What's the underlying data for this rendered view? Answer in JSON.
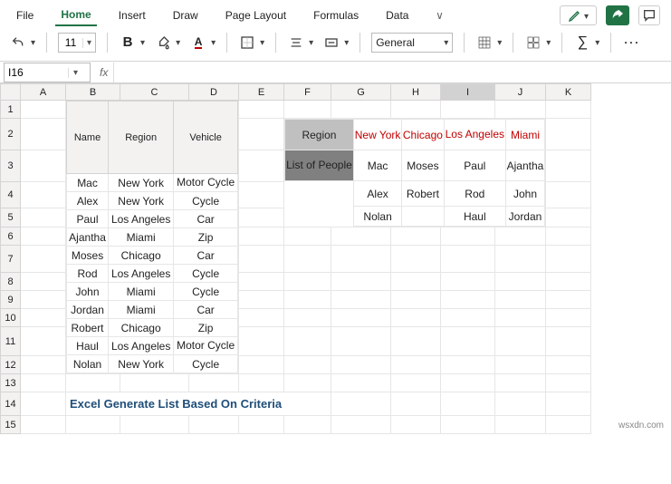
{
  "menu": {
    "file": "File",
    "home": "Home",
    "insert": "Insert",
    "draw": "Draw",
    "pageLayout": "Page Layout",
    "formulas": "Formulas",
    "data": "Data"
  },
  "toolbar": {
    "fontSize": "11",
    "bold": "B",
    "numberFormat": "General",
    "dots": "···"
  },
  "fxbar": {
    "nameBox": "I16",
    "fxLabel": "fx",
    "formula": ""
  },
  "columns": [
    "A",
    "B",
    "C",
    "D",
    "E",
    "F",
    "G",
    "H",
    "I",
    "J",
    "K"
  ],
  "rows": [
    "1",
    "2",
    "3",
    "4",
    "5",
    "6",
    "7",
    "8",
    "9",
    "10",
    "11",
    "12",
    "13",
    "14",
    "15"
  ],
  "table1": {
    "headers": [
      "Name",
      "Region",
      "Vehicle"
    ],
    "rows": [
      [
        "Mac",
        "New York",
        "Motor Cycle"
      ],
      [
        "Alex",
        "New York",
        "Cycle"
      ],
      [
        "Paul",
        "Los Angeles",
        "Car"
      ],
      [
        "Ajantha",
        "Miami",
        "Zip"
      ],
      [
        "Moses",
        "Chicago",
        "Car"
      ],
      [
        "Rod",
        "Los Angeles",
        "Cycle"
      ],
      [
        "John",
        "Miami",
        "Cycle"
      ],
      [
        "Jordan",
        "Miami",
        "Car"
      ],
      [
        "Robert",
        "Chicago",
        "Zip"
      ],
      [
        "Haul",
        "Los Angeles",
        "Motor Cycle"
      ],
      [
        "Nolan",
        "New York",
        "Cycle"
      ]
    ]
  },
  "table2": {
    "headerRow": [
      "Region",
      "New York",
      "Chicago",
      "Los Angeles",
      "Miami"
    ],
    "sideLabel": "List of People",
    "rows": [
      [
        "Mac",
        "Moses",
        "Paul",
        "Ajantha"
      ],
      [
        "Alex",
        "Robert",
        "Rod",
        "John"
      ],
      [
        "Nolan",
        "",
        "Haul",
        "Jordan"
      ]
    ]
  },
  "note": "Excel Generate List Based On Criteria",
  "watermark": "wsxdn.com",
  "activeCell": {
    "col": "I",
    "row": "16"
  }
}
